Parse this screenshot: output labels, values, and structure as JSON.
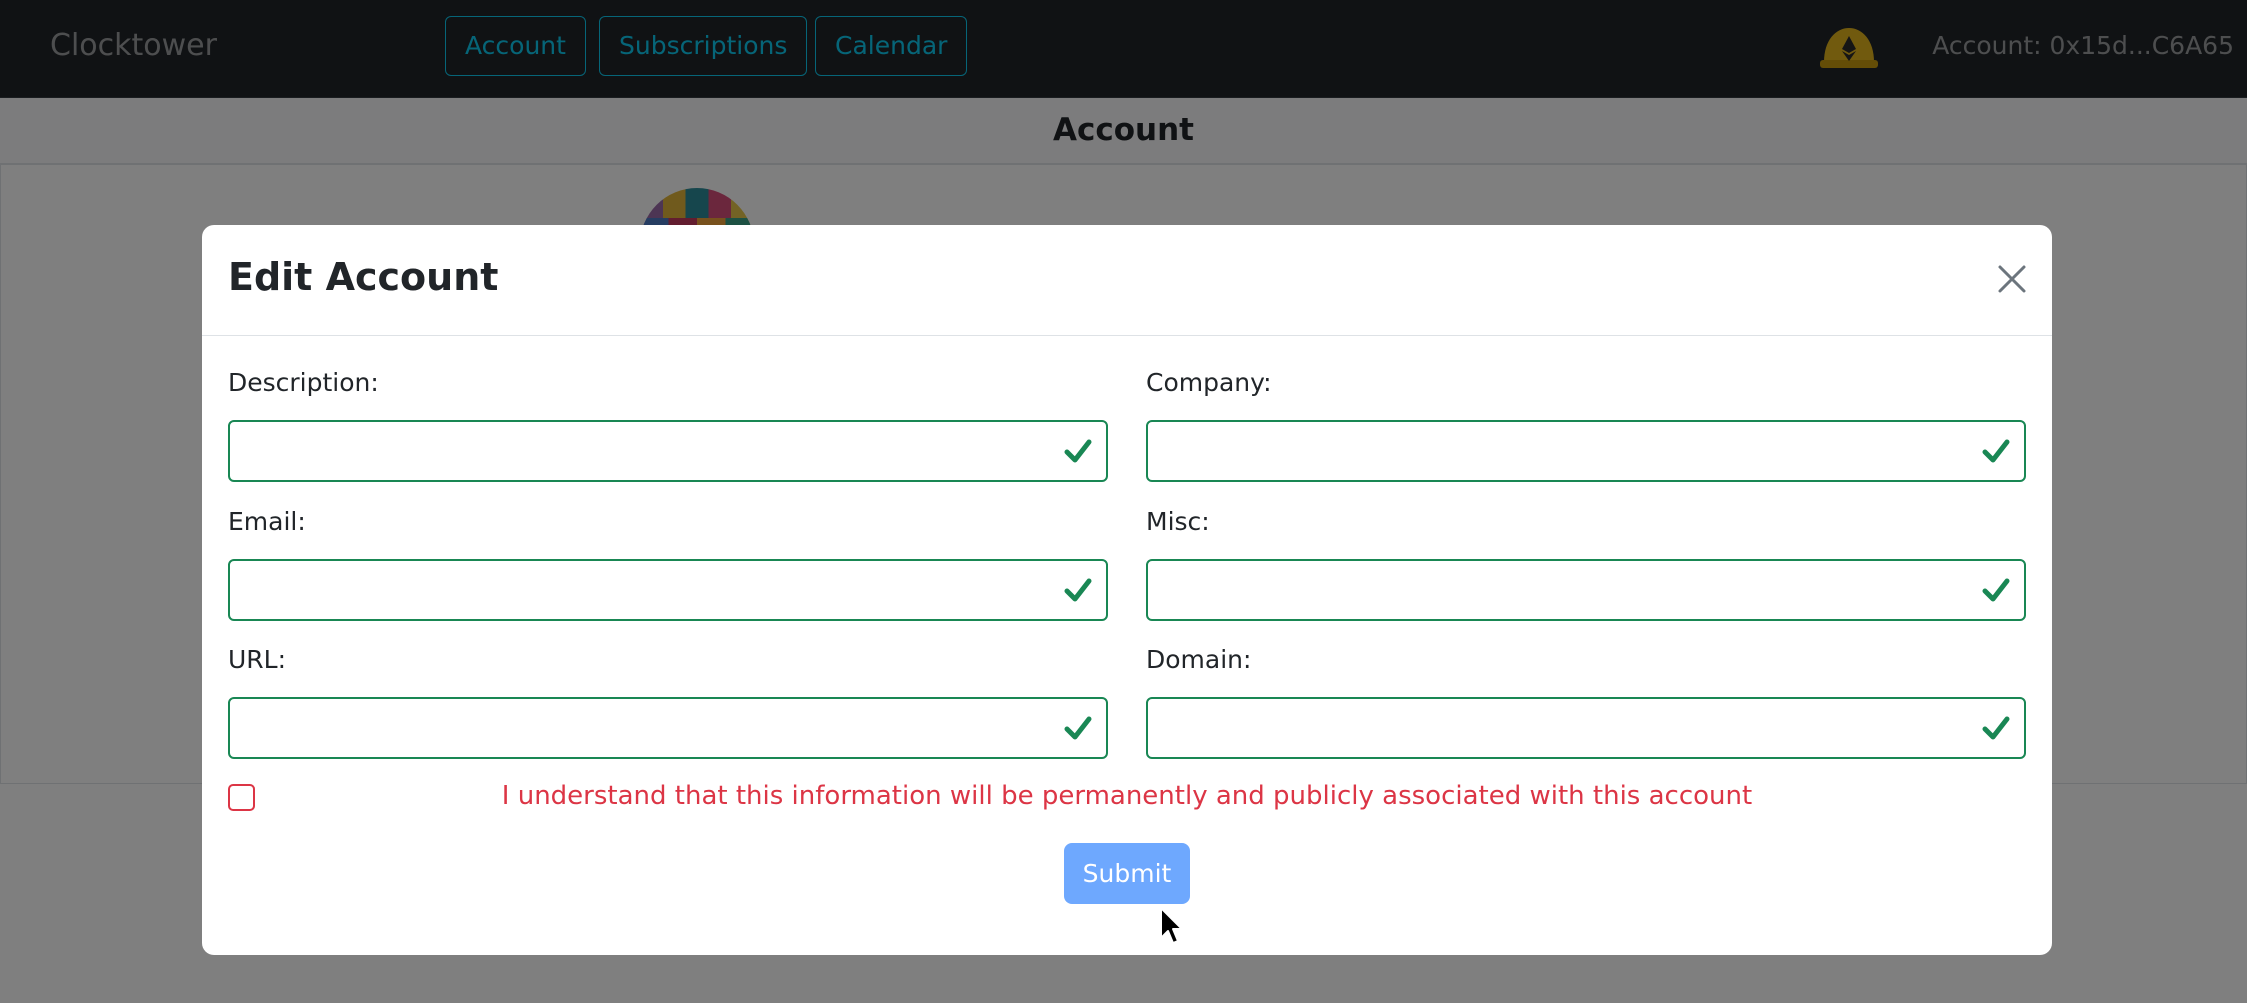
{
  "navbar": {
    "brand": "Clocktower",
    "buttons": [
      {
        "label": "Account"
      },
      {
        "label": "Subscriptions"
      },
      {
        "label": "Calendar"
      }
    ],
    "wallet_icon": "ethereum-helmet-icon",
    "account_label": "Account: 0x15d...C6A65"
  },
  "page": {
    "title": "Account"
  },
  "modal": {
    "title": "Edit Account",
    "close_icon": "close-icon",
    "fields": {
      "description": {
        "label": "Description:",
        "value": ""
      },
      "company": {
        "label": "Company:",
        "value": ""
      },
      "email": {
        "label": "Email:",
        "value": ""
      },
      "misc": {
        "label": "Misc:",
        "value": ""
      },
      "url": {
        "label": "URL:",
        "value": ""
      },
      "domain": {
        "label": "Domain:",
        "value": ""
      }
    },
    "validation_icon": "checkmark-icon",
    "consent": {
      "checked": false,
      "text": "I understand that this information will be permanently and publicly associated with this account"
    },
    "submit_label": "Submit"
  },
  "colors": {
    "navbar_bg": "#212529",
    "nav_accent": "#0dcaf0",
    "valid_green": "#198754",
    "error_red": "#dc3545",
    "submit_blue": "#6ea8fe"
  }
}
